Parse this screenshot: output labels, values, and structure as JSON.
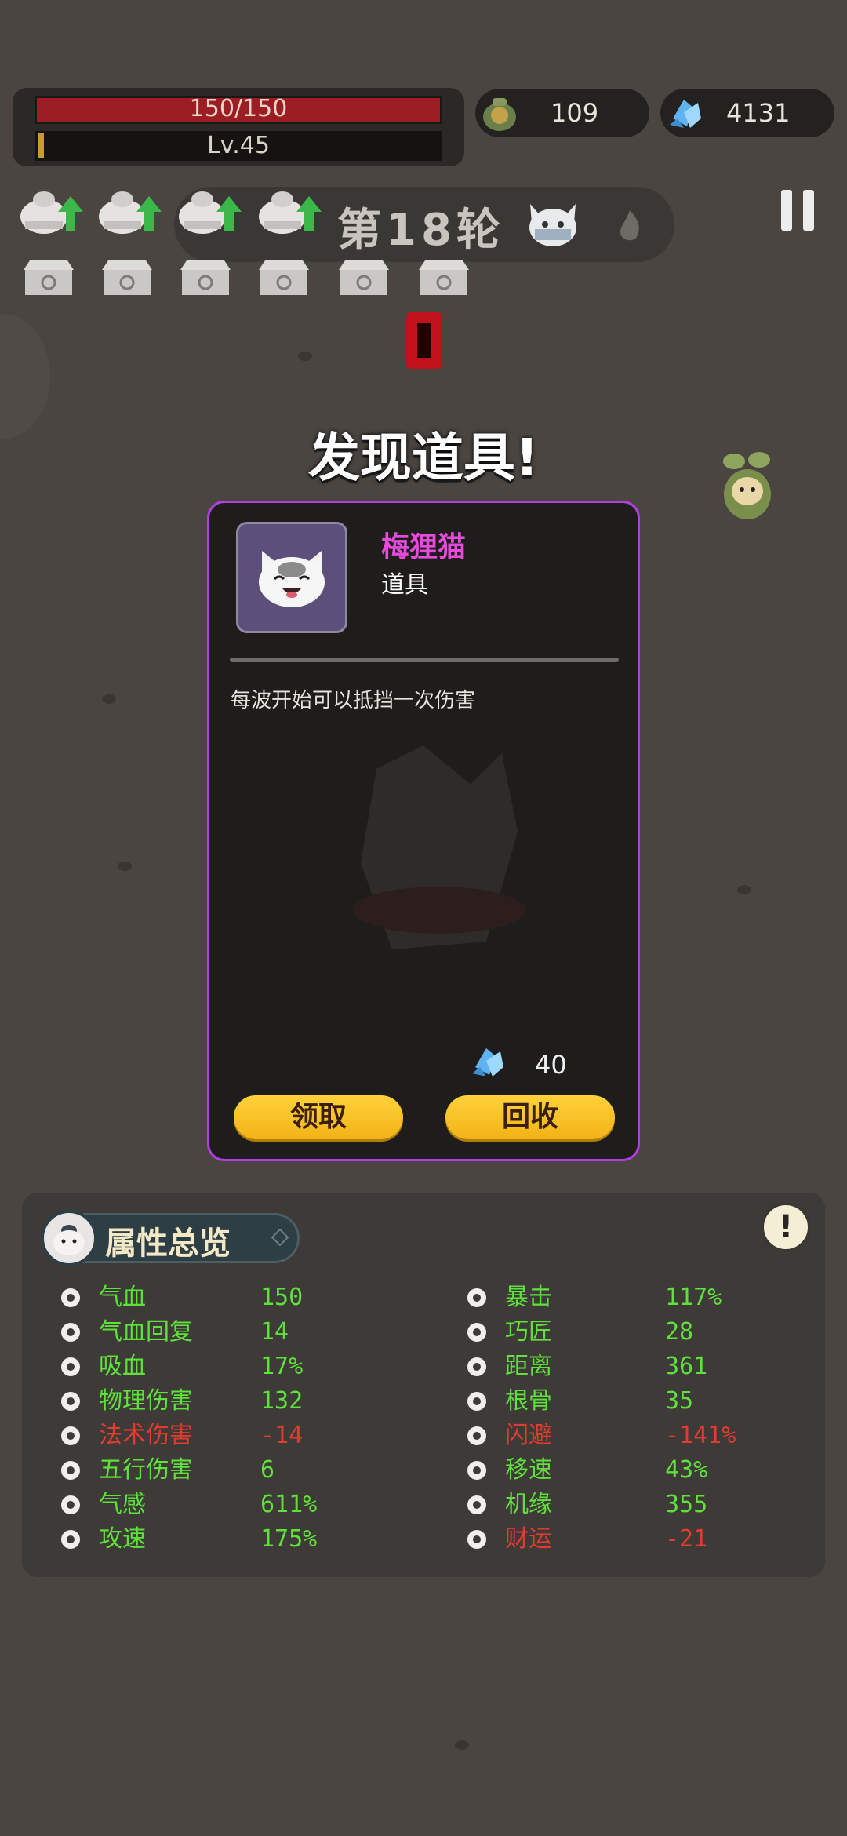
{
  "hud": {
    "hp_text": "150/150",
    "level_text": "Lv.45",
    "coins": "109",
    "gems": "4131",
    "wave_text": "第18轮"
  },
  "popup": {
    "title": "发现道具!",
    "item_name": "梅狸猫",
    "item_type": "道具",
    "item_desc": "每波开始可以抵挡一次伤害",
    "price": "40",
    "take_label": "领取",
    "recycle_label": "回收"
  },
  "attributes": {
    "title": "属性总览",
    "info_icon": "!",
    "left": [
      {
        "label": "气血",
        "value": "150",
        "color": "green",
        "icon": "heart-icon"
      },
      {
        "label": "气血回复",
        "value": "14",
        "color": "green",
        "icon": "heart-regen-icon"
      },
      {
        "label": "吸血",
        "value": "17%",
        "color": "green",
        "icon": "blood-drop-icon"
      },
      {
        "label": "物理伤害",
        "value": "132",
        "color": "green",
        "icon": "sword-icon"
      },
      {
        "label": "法术伤害",
        "value": "-14",
        "color": "red",
        "icon": "spell-swirl-icon"
      },
      {
        "label": "五行伤害",
        "value": "6",
        "color": "green",
        "icon": "spiral-icon"
      },
      {
        "label": "气感",
        "value": "611%",
        "color": "green",
        "icon": "qi-icon"
      },
      {
        "label": "攻速",
        "value": "175%",
        "color": "green",
        "icon": "attack-speed-icon"
      }
    ],
    "right": [
      {
        "label": "暴击",
        "value": "117%",
        "color": "green",
        "icon": "crit-icon"
      },
      {
        "label": "巧匠",
        "value": "28",
        "color": "green",
        "icon": "hammer-icon"
      },
      {
        "label": "距离",
        "value": "361",
        "color": "green",
        "icon": "target-icon"
      },
      {
        "label": "根骨",
        "value": "35",
        "color": "green",
        "icon": "body-icon"
      },
      {
        "label": "闪避",
        "value": "-141%",
        "color": "red",
        "icon": "dodge-icon"
      },
      {
        "label": "移速",
        "value": "43%",
        "color": "green",
        "icon": "boot-icon"
      },
      {
        "label": "机缘",
        "value": "355",
        "color": "green",
        "icon": "fortune-cycle-icon"
      },
      {
        "label": "财运",
        "value": "-21",
        "color": "red",
        "icon": "coin-ring-icon"
      }
    ]
  },
  "colors": {
    "accent_purple": "#b43ee6",
    "item_name": "#e64bdc",
    "positive": "#5fe03c",
    "negative": "#e23b2f",
    "button_yellow": "#f6c025",
    "hp_red": "#9c1e24"
  }
}
